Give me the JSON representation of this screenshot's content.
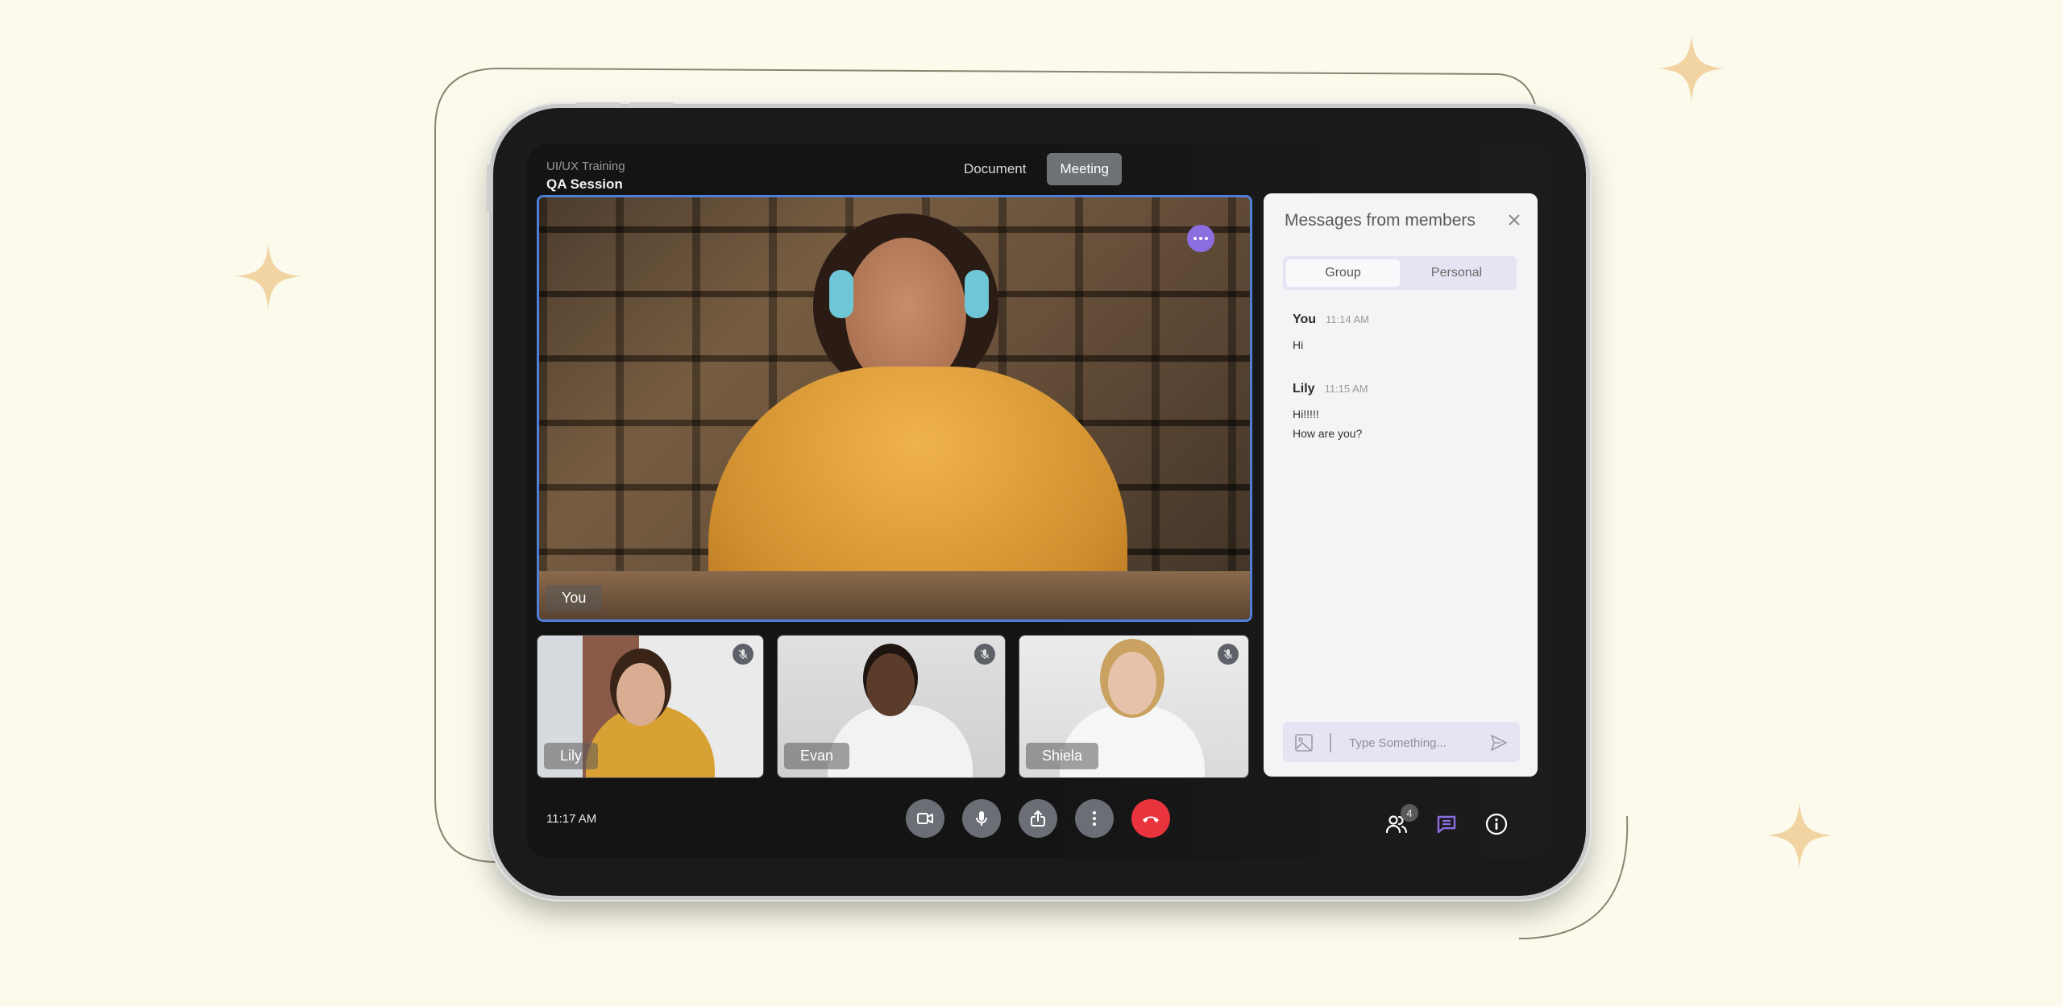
{
  "header": {
    "subtitle": "UI/UX Training",
    "title": "QA Session"
  },
  "tabs": [
    {
      "label": "Document",
      "active": false
    },
    {
      "label": "Meeting",
      "active": true
    }
  ],
  "main_video": {
    "name": "You",
    "more_icon": "more-horizontal-icon",
    "border_color": "#4f7fd6"
  },
  "participants": [
    {
      "name": "Lily",
      "muted": true
    },
    {
      "name": "Evan",
      "muted": true
    },
    {
      "name": "Shiela",
      "muted": true
    }
  ],
  "chat": {
    "title": "Messages from members",
    "tabs": [
      {
        "label": "Group",
        "active": true
      },
      {
        "label": "Personal",
        "active": false
      }
    ],
    "messages": [
      {
        "sender": "You",
        "time": "11:14 AM",
        "lines": [
          "Hi"
        ]
      },
      {
        "sender": "Lily",
        "time": "11:15 AM",
        "lines": [
          "Hi!!!!!",
          "How are you?"
        ]
      }
    ],
    "input_placeholder": "Type Something...",
    "input_value": ""
  },
  "footer": {
    "time": "11:17 AM",
    "controls": [
      "video-camera-icon",
      "microphone-icon",
      "share-screen-icon",
      "more-vertical-icon",
      "end-call-icon"
    ],
    "participants_count": "4",
    "end_call_color": "#e9333d",
    "accent_color": "#8b6ee0"
  }
}
